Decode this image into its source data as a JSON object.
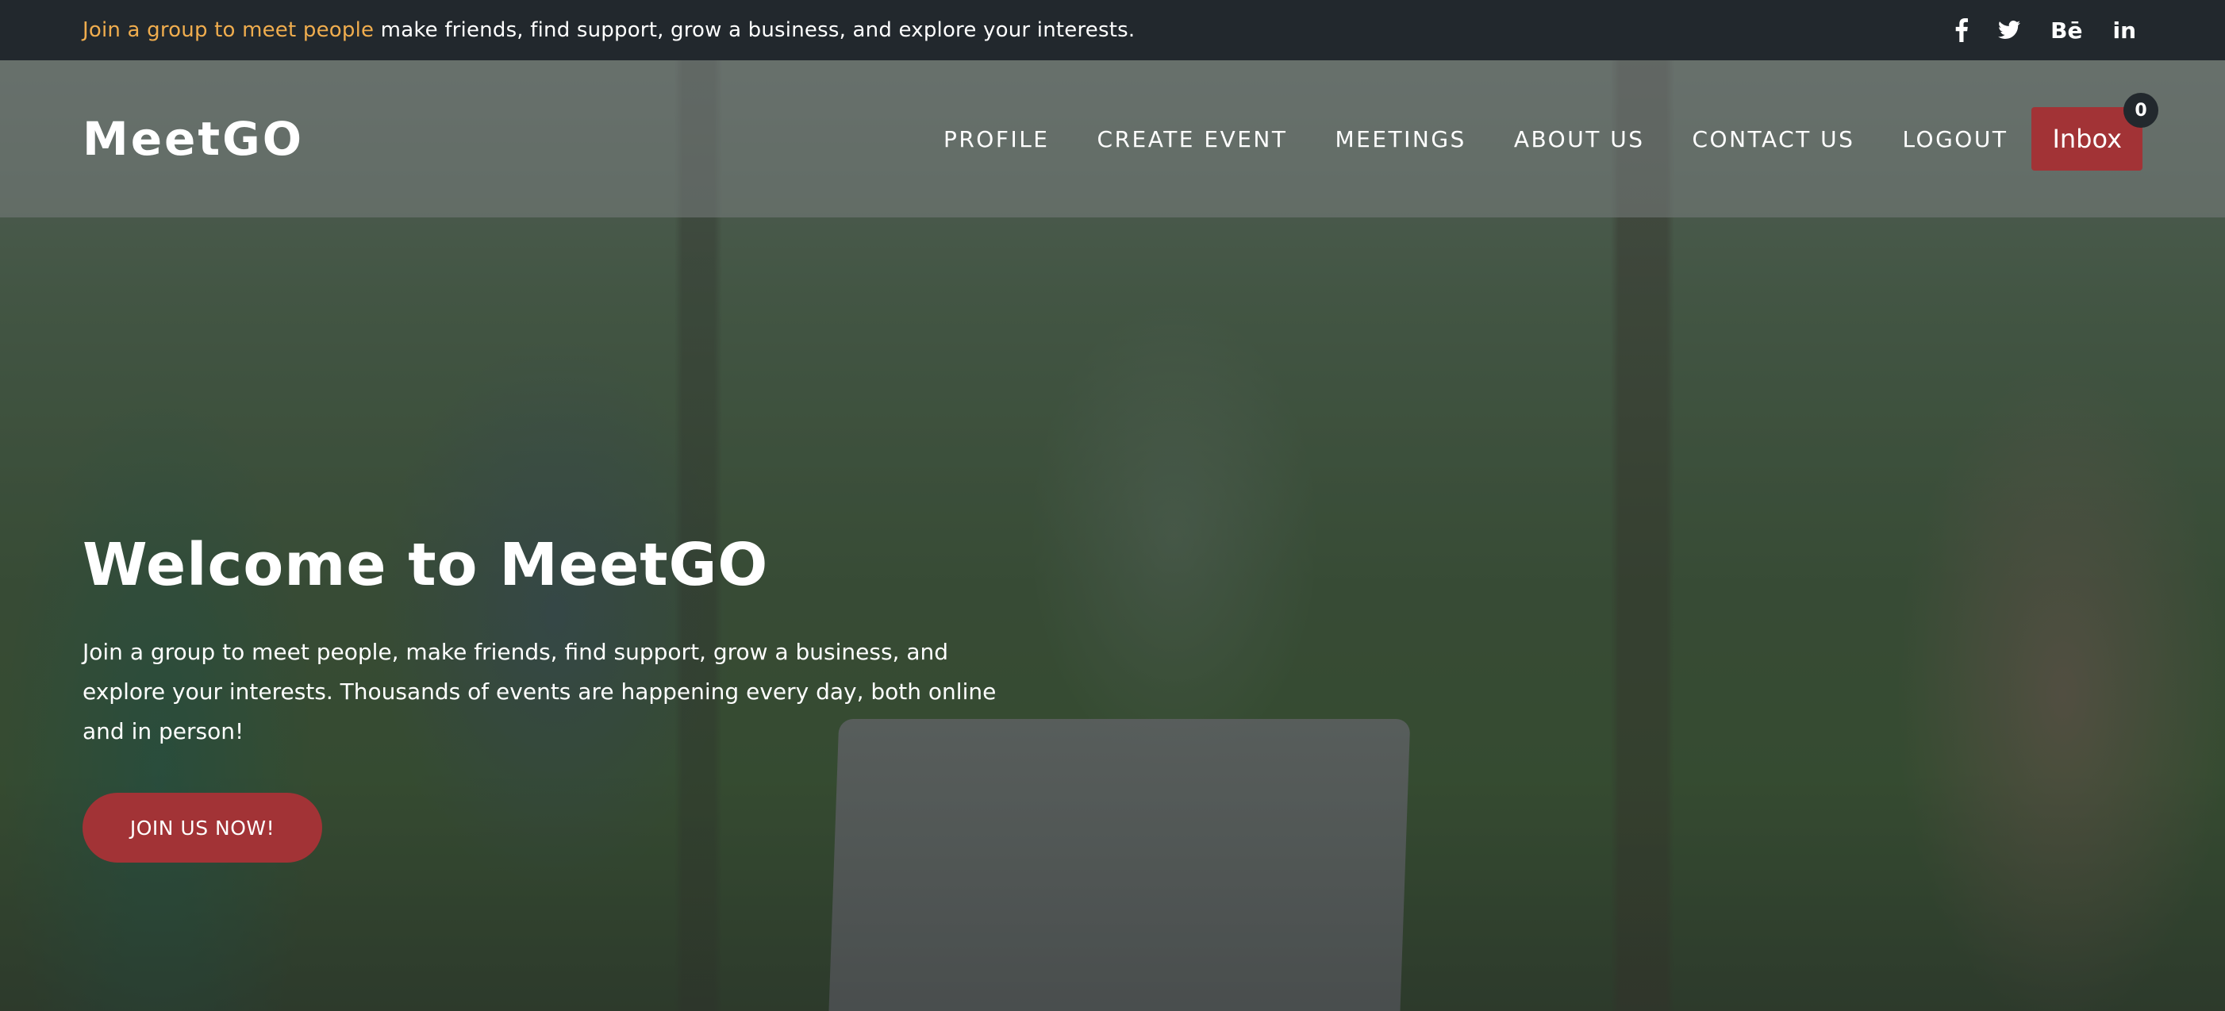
{
  "topbar": {
    "highlight_text": "Join a group to meet people",
    "rest_text": " make friends, find support, grow a business, and explore your interests.",
    "social": [
      {
        "icon": "facebook-icon"
      },
      {
        "icon": "twitter-icon"
      },
      {
        "icon": "behance-icon",
        "glyph": "Bē"
      },
      {
        "icon": "linkedin-icon",
        "glyph": "in"
      }
    ]
  },
  "navbar": {
    "logo": "MeetGO",
    "links": [
      "PROFILE",
      "CREATE EVENT",
      "MEETINGS",
      "ABOUT US",
      "CONTACT US",
      "LOGOUT"
    ],
    "inbox_label": "Inbox",
    "inbox_count": "0"
  },
  "hero": {
    "title": "Welcome to MeetGO",
    "description": "Join a group to meet people, make friends, find support, grow a business, and explore your interests. Thousands of events are happening every day, both online and in person!",
    "cta_label": "JOIN US NOW!"
  },
  "colors": {
    "topbar_bg": "#22282d",
    "highlight": "#f0ad4e",
    "accent_red": "#a23336"
  }
}
